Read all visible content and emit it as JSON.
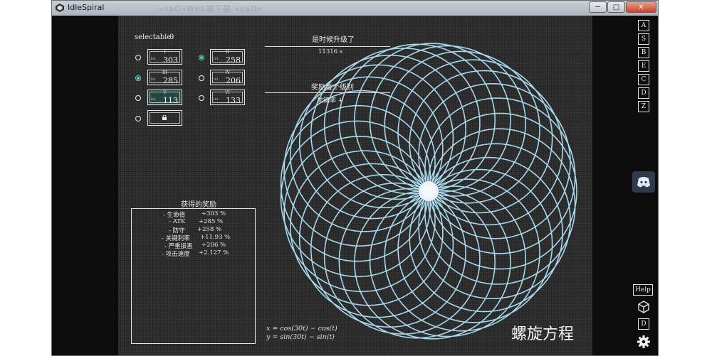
{
  "window": {
    "title": "IdleSpiral",
    "ghost_text": "«saO»Web端下载 «saO»",
    "buttons": {
      "minimize": "─",
      "maximize": "□",
      "close": "✕"
    }
  },
  "selectable": {
    "label": "selectable:",
    "value": "0"
  },
  "slots": [
    {
      "roman": "I",
      "lvl_label": "lvl.",
      "value": "303",
      "selected": false,
      "radio_on": false
    },
    {
      "roman": "II",
      "lvl_label": "lvl.",
      "value": "258",
      "selected": false,
      "radio_on": true
    },
    {
      "roman": "III",
      "lvl_label": "lvl.",
      "value": "285",
      "selected": false,
      "radio_on": true
    },
    {
      "roman": "IV",
      "lvl_label": "lvl.",
      "value": "206",
      "selected": false,
      "radio_on": false
    },
    {
      "roman": "V",
      "lvl_label": "lvl.",
      "value": "113",
      "selected": true,
      "radio_on": false
    },
    {
      "roman": "VI",
      "lvl_label": "lvl.",
      "value": "133",
      "selected": false,
      "radio_on": false
    }
  ],
  "upgrade": {
    "header": "是时候升级了",
    "time": "11316 s",
    "reward_header": "奖励每个级别",
    "reward_item": "关键率 +"
  },
  "rewards": {
    "title": "获得的奖励",
    "items": [
      {
        "name": "- 生命值",
        "value": "+303 %"
      },
      {
        "name": "- ATK",
        "value": "+285 %"
      },
      {
        "name": "- 防守",
        "value": "+258 %"
      },
      {
        "name": "- 关键利率",
        "value": "+11.93 %"
      },
      {
        "name": "- 严重损害",
        "value": "+206 %"
      },
      {
        "name": "- 攻击速度",
        "value": "+2.127 %"
      }
    ]
  },
  "formula": {
    "x": "x = cos(30t) − cos(t)",
    "y": "y = sin(30t) − sin(t)"
  },
  "spiral_title": "螺旋方程",
  "side_buttons": [
    "A",
    "S",
    "B",
    "E",
    "C",
    "D",
    "Z"
  ],
  "help_label": "Help",
  "d_label": "D",
  "icons": {
    "discord": "discord-icon",
    "cube": "cube-icon",
    "gear": "gear-icon",
    "lock": "lock-icon"
  },
  "colors": {
    "accent": "#4fd6c2",
    "spiral": "#a8d8ec",
    "panel": "#2a2a2a"
  }
}
